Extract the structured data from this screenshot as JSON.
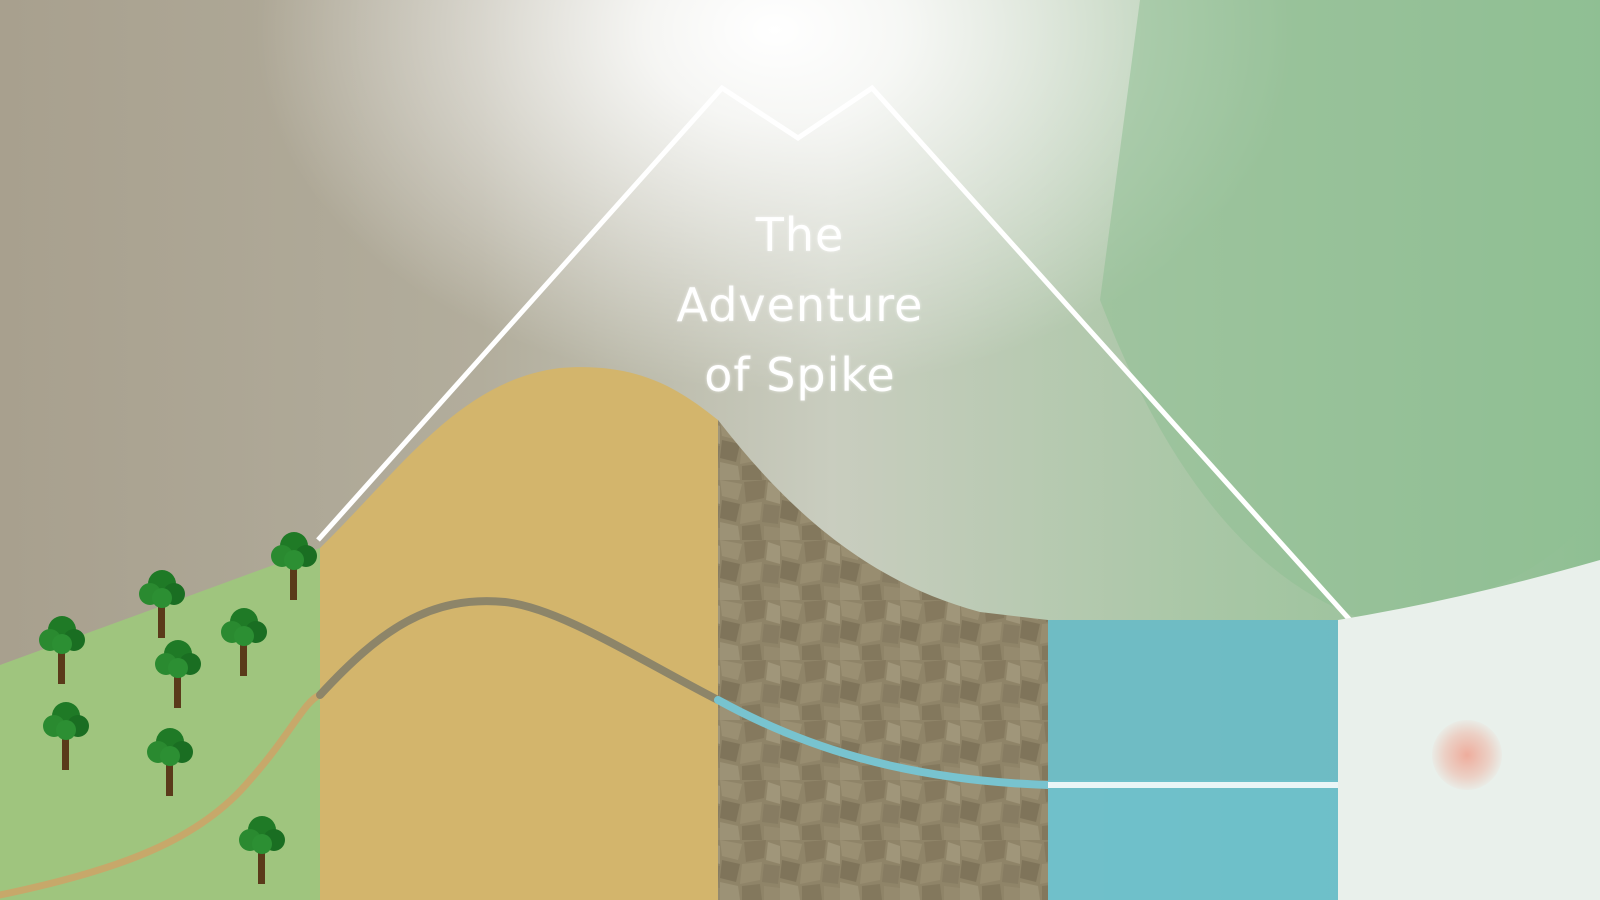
{
  "game": {
    "title": "The\nAdventure\nof Spike"
  },
  "zones": [
    {
      "name": "forest",
      "color": "#9fc57e"
    },
    {
      "name": "desert",
      "color": "#d3b56c"
    },
    {
      "name": "rock",
      "color": "#8f8468"
    },
    {
      "name": "water",
      "color": "#68bfcd"
    },
    {
      "name": "snow",
      "color": "#e9f0eb"
    }
  ],
  "colors": {
    "path_forest": "#c7a86a",
    "path_desert": "#8d8569",
    "path_rock": "#78c3cf",
    "path_water": "#ffffff",
    "mountain_outline": "#ffffff",
    "tree_foliage": "#1f7a26",
    "tree_trunk": "#5a3a1a"
  },
  "icons": [
    "tree-icon",
    "goal-marker-icon"
  ]
}
